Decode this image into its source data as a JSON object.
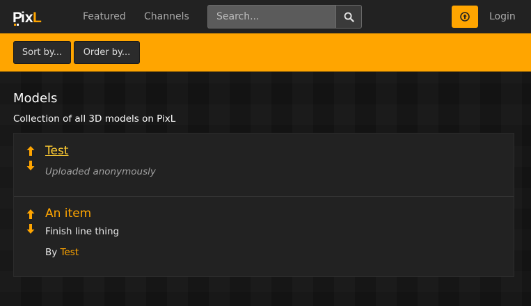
{
  "brand": {
    "logo_text": "PixL",
    "accent_color": "#ffa500"
  },
  "nav": {
    "links": [
      {
        "label": "Featured"
      },
      {
        "label": "Channels"
      }
    ],
    "search": {
      "placeholder": "Search...",
      "value": ""
    },
    "login_label": "Login",
    "icons": {
      "search": "search-icon",
      "upload": "upload-icon"
    }
  },
  "toolbar": {
    "sort_label": "Sort by...",
    "order_label": "Order by..."
  },
  "main": {
    "title": "Models",
    "subtitle": "Collection of all 3D models on PixL",
    "items": [
      {
        "title": "Test",
        "meta": "Uploaded anonymously",
        "author_prefix": "",
        "author": ""
      },
      {
        "title": "An item",
        "meta": "Finish line thing",
        "author_prefix": "By ",
        "author": "Test"
      }
    ]
  }
}
